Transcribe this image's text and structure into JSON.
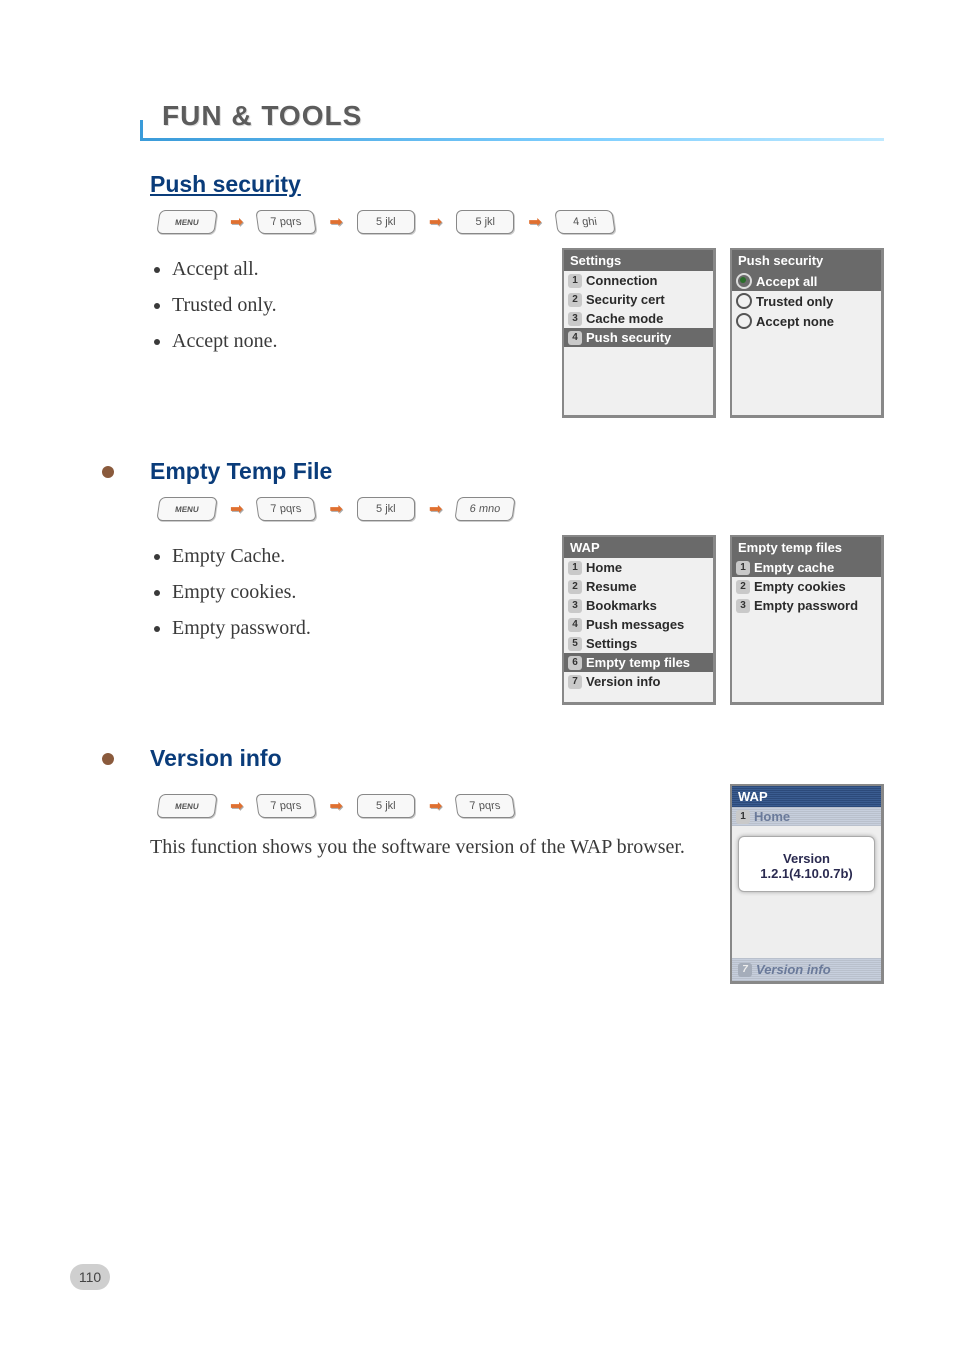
{
  "page_title": "FUN & TOOLS",
  "page_number": "110",
  "arrow_glyph": "➡",
  "sections": {
    "push_security": {
      "title": "Push security",
      "keys": [
        "MENU",
        "7 pqrs",
        "5 jkl",
        "5 jkl",
        "4 ghi"
      ],
      "bullets": [
        "Accept all.",
        "Trusted only.",
        "Accept none."
      ],
      "screen_settings": {
        "title": "Settings",
        "items": [
          {
            "num": "1",
            "label": "Connection"
          },
          {
            "num": "2",
            "label": "Security cert"
          },
          {
            "num": "3",
            "label": "Cache mode"
          },
          {
            "num": "4",
            "label": "Push security",
            "selected": true
          }
        ]
      },
      "screen_options": {
        "title": "Push security",
        "items": [
          {
            "label": "Accept all",
            "selected": true,
            "radio_on": true
          },
          {
            "label": "Trusted only",
            "radio_on": false
          },
          {
            "label": "Accept none",
            "radio_on": false
          }
        ]
      }
    },
    "empty_temp": {
      "title": "Empty Temp File",
      "keys": [
        "MENU",
        "7 pqrs",
        "5 jkl",
        "6 mno"
      ],
      "bullets": [
        "Empty Cache.",
        "Empty cookies.",
        "Empty password."
      ],
      "screen_wap": {
        "title": "WAP",
        "items": [
          {
            "num": "1",
            "label": "Home"
          },
          {
            "num": "2",
            "label": "Resume"
          },
          {
            "num": "3",
            "label": "Bookmarks"
          },
          {
            "num": "4",
            "label": "Push messages"
          },
          {
            "num": "5",
            "label": "Settings"
          },
          {
            "num": "6",
            "label": "Empty temp files",
            "selected": true
          },
          {
            "num": "7",
            "label": "Version info"
          }
        ]
      },
      "screen_empty": {
        "title": "Empty temp files",
        "items": [
          {
            "num": "1",
            "label": "Empty cache",
            "selected": true
          },
          {
            "num": "2",
            "label": "Empty cookies"
          },
          {
            "num": "3",
            "label": "Empty password"
          }
        ]
      }
    },
    "version_info": {
      "title": "Version info",
      "keys": [
        "MENU",
        "7 pqrs",
        "5 jkl",
        "7 pqrs"
      ],
      "paragraph": "This function shows you the software version of the WAP browser.",
      "screen": {
        "title": "WAP",
        "top_item": {
          "num": "1",
          "label": "Home"
        },
        "popup_line1": "Version",
        "popup_line2": "1.2.1(4.10.0.7b)",
        "bottom_item": {
          "num": "7",
          "label": "Version info"
        }
      }
    }
  }
}
